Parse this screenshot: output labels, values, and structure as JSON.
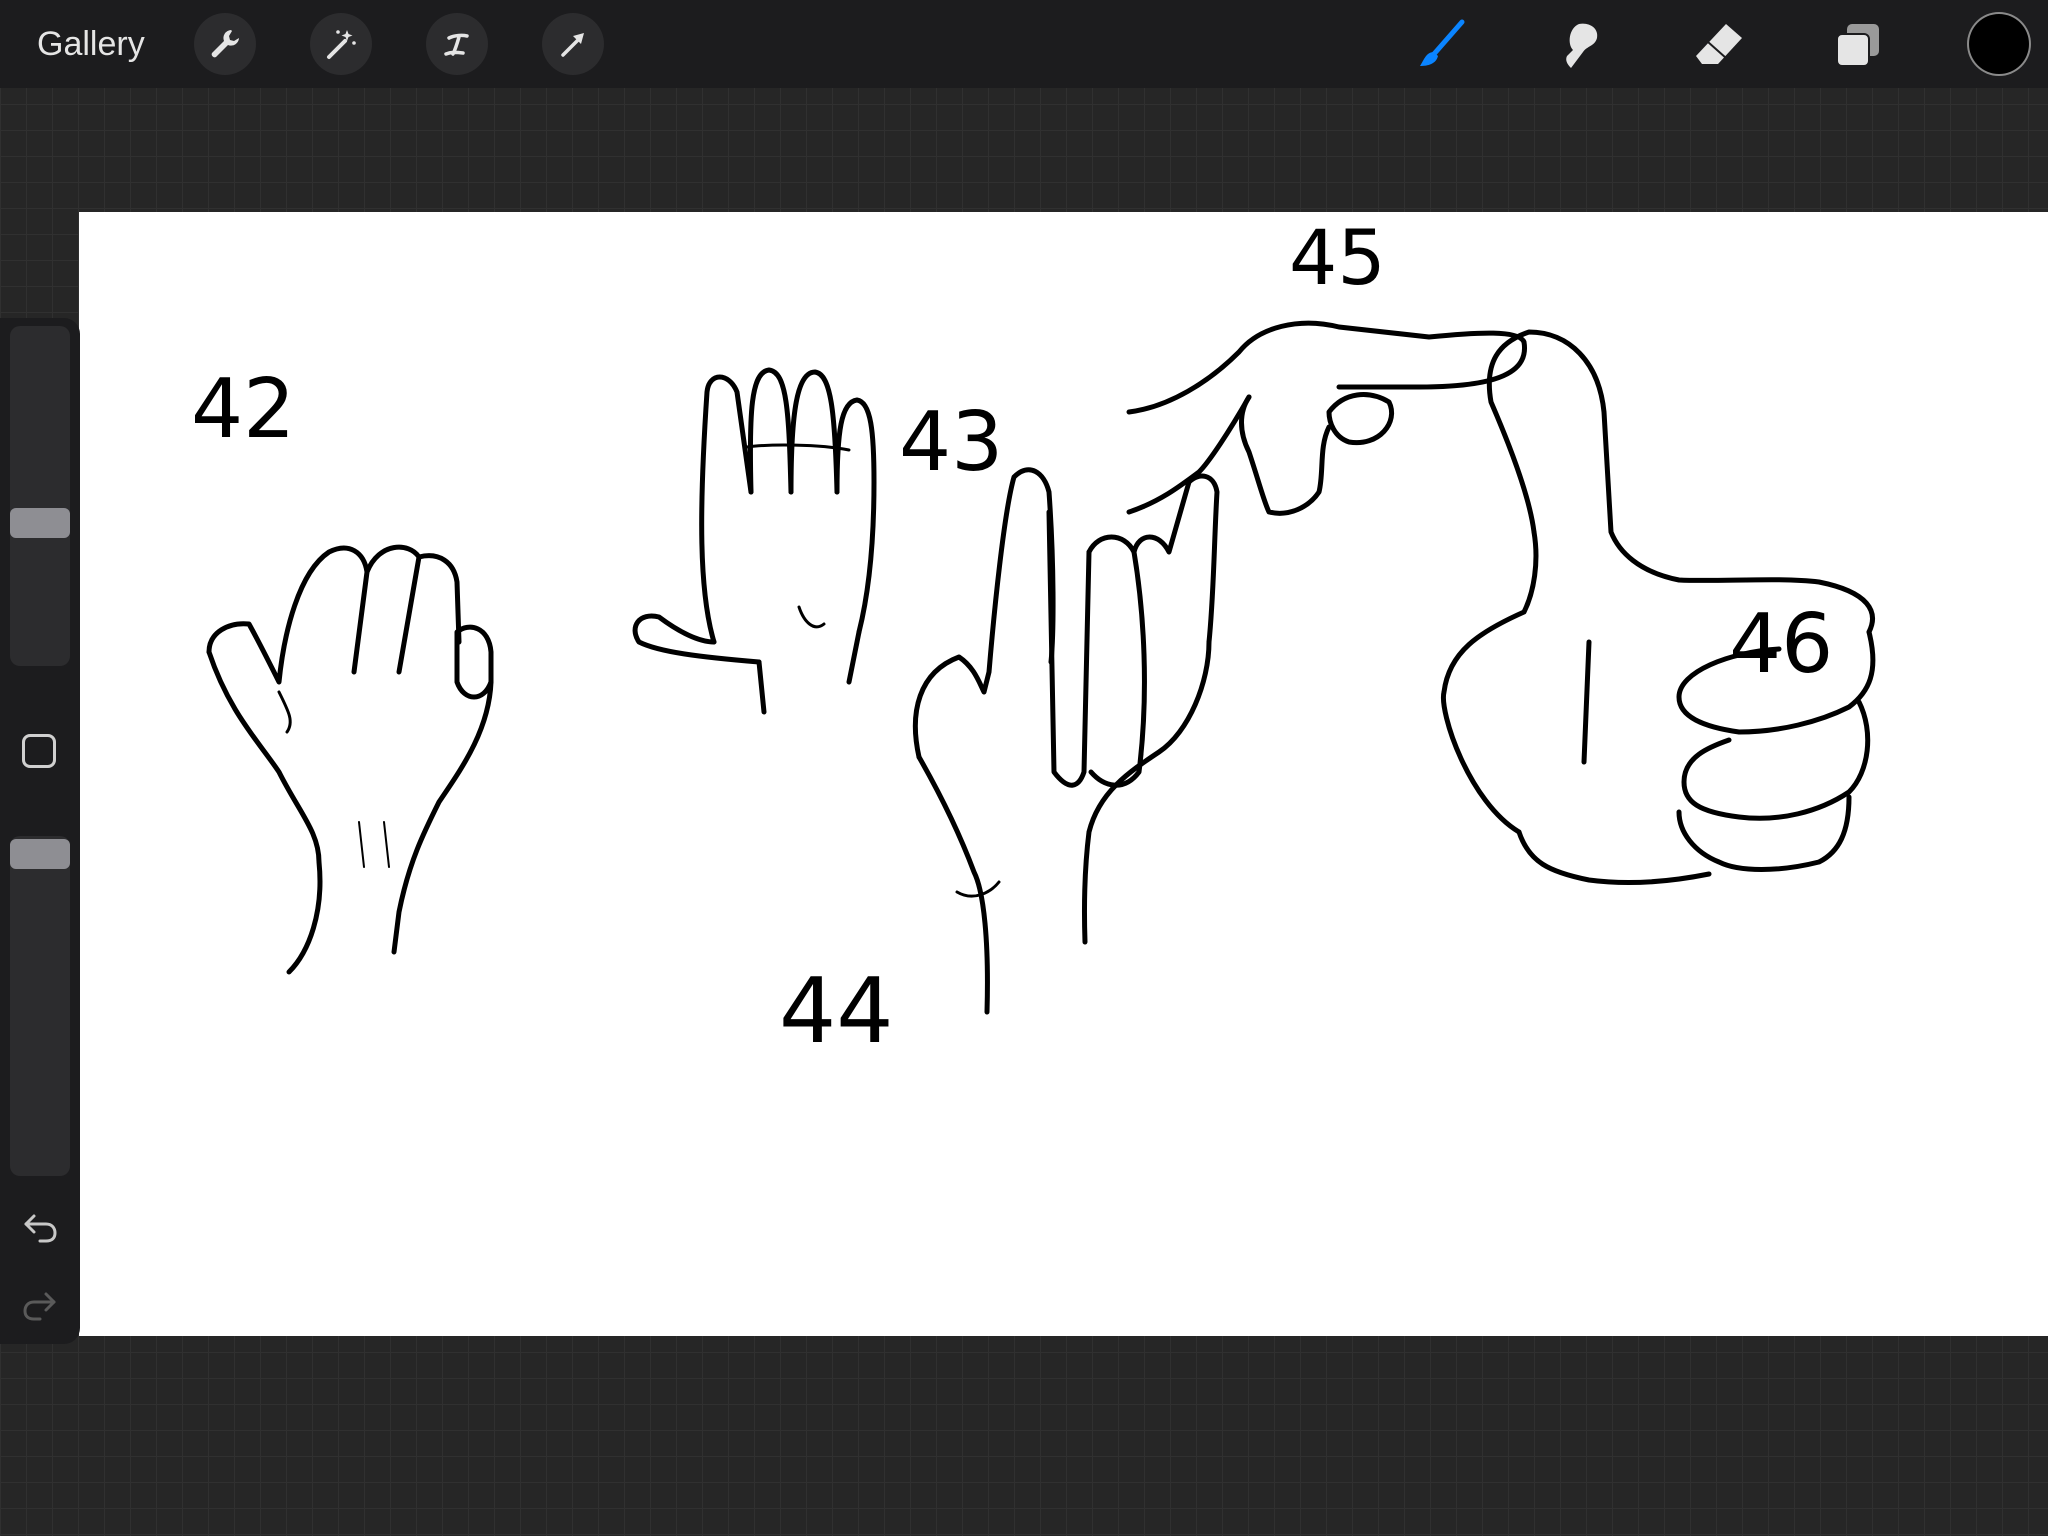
{
  "topbar": {
    "gallery_label": "Gallery",
    "left_tools": [
      "wrench-icon",
      "magic-wand-icon",
      "selection-icon",
      "transform-arrow-icon"
    ],
    "right_tools": [
      "brush-icon",
      "smudge-icon",
      "eraser-icon",
      "layers-icon"
    ],
    "active_tool": "brush-icon",
    "accent_color": "#0a84ff",
    "current_color": "#000000"
  },
  "sidebar": {
    "brush_size_level": 0.58,
    "opacity_level": 0.98,
    "icons": [
      "modify-square-icon",
      "undo-icon",
      "redo-icon"
    ]
  },
  "canvas": {
    "labels": {
      "l42": "42",
      "l43": "43",
      "l44": "44",
      "l45": "45",
      "l46": "46"
    }
  }
}
